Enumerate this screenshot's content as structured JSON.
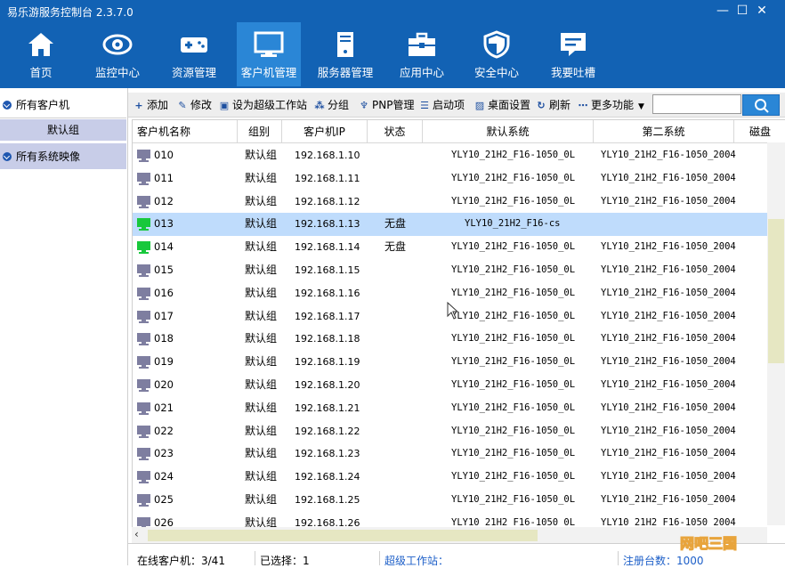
{
  "app": {
    "title": "易乐游服务控制台 2.3.7.0"
  },
  "window_controls": {
    "minimize": "—",
    "maximize": "☐",
    "close": "✕"
  },
  "nav": [
    {
      "label": "首页",
      "icon": "home-icon"
    },
    {
      "label": "监控中心",
      "icon": "eye-icon"
    },
    {
      "label": "资源管理",
      "icon": "gamepad-icon"
    },
    {
      "label": "客户机管理",
      "icon": "monitor-icon",
      "active": true
    },
    {
      "label": "服务器管理",
      "icon": "server-icon"
    },
    {
      "label": "应用中心",
      "icon": "toolbox-icon"
    },
    {
      "label": "安全中心",
      "icon": "shield-icon"
    },
    {
      "label": "我要吐槽",
      "icon": "chat-icon"
    }
  ],
  "sidebar": {
    "all_clients": "所有客户机",
    "default_group": "默认组",
    "all_images": "所有系统映像"
  },
  "toolbar": {
    "add": "添加",
    "edit": "修改",
    "set_super": "设为超级工作站",
    "group": "分组",
    "pnp": "PNP管理",
    "boot": "启动项",
    "desktop": "桌面设置",
    "refresh": "刷新",
    "more": "更多功能",
    "search_placeholder": ""
  },
  "table": {
    "columns": [
      "客户机名称",
      "组别",
      "客户机IP",
      "状态",
      "默认系统",
      "第二系统",
      "磁盘"
    ],
    "rows": [
      {
        "name": "010",
        "group": "默认组",
        "ip": "192.168.1.10",
        "status": "",
        "sys1": "YLY10_21H2_F16-1050_0L",
        "sys2": "YLY10_21H2_F16-1050_2004",
        "online": false
      },
      {
        "name": "011",
        "group": "默认组",
        "ip": "192.168.1.11",
        "status": "",
        "sys1": "YLY10_21H2_F16-1050_0L",
        "sys2": "YLY10_21H2_F16-1050_2004",
        "online": false
      },
      {
        "name": "012",
        "group": "默认组",
        "ip": "192.168.1.12",
        "status": "",
        "sys1": "YLY10_21H2_F16-1050_0L",
        "sys2": "YLY10_21H2_F16-1050_2004",
        "online": false
      },
      {
        "name": "013",
        "group": "默认组",
        "ip": "192.168.1.13",
        "status": "无盘",
        "sys1": "YLY10_21H2_F16-cs",
        "sys2": "",
        "online": true,
        "selected": true
      },
      {
        "name": "014",
        "group": "默认组",
        "ip": "192.168.1.14",
        "status": "无盘",
        "sys1": "YLY10_21H2_F16-1050_0L",
        "sys2": "YLY10_21H2_F16-1050_2004",
        "online": true
      },
      {
        "name": "015",
        "group": "默认组",
        "ip": "192.168.1.15",
        "status": "",
        "sys1": "YLY10_21H2_F16-1050_0L",
        "sys2": "YLY10_21H2_F16-1050_2004",
        "online": false
      },
      {
        "name": "016",
        "group": "默认组",
        "ip": "192.168.1.16",
        "status": "",
        "sys1": "YLY10_21H2_F16-1050_0L",
        "sys2": "YLY10_21H2_F16-1050_2004",
        "online": false
      },
      {
        "name": "017",
        "group": "默认组",
        "ip": "192.168.1.17",
        "status": "",
        "sys1": "YLY10_21H2_F16-1050_0L",
        "sys2": "YLY10_21H2_F16-1050_2004",
        "online": false
      },
      {
        "name": "018",
        "group": "默认组",
        "ip": "192.168.1.18",
        "status": "",
        "sys1": "YLY10_21H2_F16-1050_0L",
        "sys2": "YLY10_21H2_F16-1050_2004",
        "online": false
      },
      {
        "name": "019",
        "group": "默认组",
        "ip": "192.168.1.19",
        "status": "",
        "sys1": "YLY10_21H2_F16-1050_0L",
        "sys2": "YLY10_21H2_F16-1050_2004",
        "online": false
      },
      {
        "name": "020",
        "group": "默认组",
        "ip": "192.168.1.20",
        "status": "",
        "sys1": "YLY10_21H2_F16-1050_0L",
        "sys2": "YLY10_21H2_F16-1050_2004",
        "online": false
      },
      {
        "name": "021",
        "group": "默认组",
        "ip": "192.168.1.21",
        "status": "",
        "sys1": "YLY10_21H2_F16-1050_0L",
        "sys2": "YLY10_21H2_F16-1050_2004",
        "online": false
      },
      {
        "name": "022",
        "group": "默认组",
        "ip": "192.168.1.22",
        "status": "",
        "sys1": "YLY10_21H2_F16-1050_0L",
        "sys2": "YLY10_21H2_F16-1050_2004",
        "online": false
      },
      {
        "name": "023",
        "group": "默认组",
        "ip": "192.168.1.23",
        "status": "",
        "sys1": "YLY10_21H2_F16-1050_0L",
        "sys2": "YLY10_21H2_F16-1050_2004",
        "online": false
      },
      {
        "name": "024",
        "group": "默认组",
        "ip": "192.168.1.24",
        "status": "",
        "sys1": "YLY10_21H2_F16-1050_0L",
        "sys2": "YLY10_21H2_F16-1050_2004",
        "online": false
      },
      {
        "name": "025",
        "group": "默认组",
        "ip": "192.168.1.25",
        "status": "",
        "sys1": "YLY10_21H2_F16-1050_0L",
        "sys2": "YLY10_21H2_F16-1050_2004",
        "online": false
      },
      {
        "name": "026",
        "group": "默认组",
        "ip": "192.168.1.26",
        "status": "",
        "sys1": "YLY10_21H2_F16-1050_0L",
        "sys2": "YLY10_21H2_F16-1050_2004",
        "online": false
      }
    ]
  },
  "statusbar": {
    "online": "在线客户机：3/41",
    "selected": "已选择：1",
    "super_ws": "超级工作站：",
    "registered": "注册台数：1000"
  },
  "watermark": "网吧三国",
  "colors": {
    "banner": "#1262b4",
    "nav_active": "#2a86d6",
    "selected_row": "#bfdcfc",
    "online_pc": "#18c83c",
    "offline_pc": "#7e7ea0",
    "sidebar_group": "#c8cde8"
  }
}
